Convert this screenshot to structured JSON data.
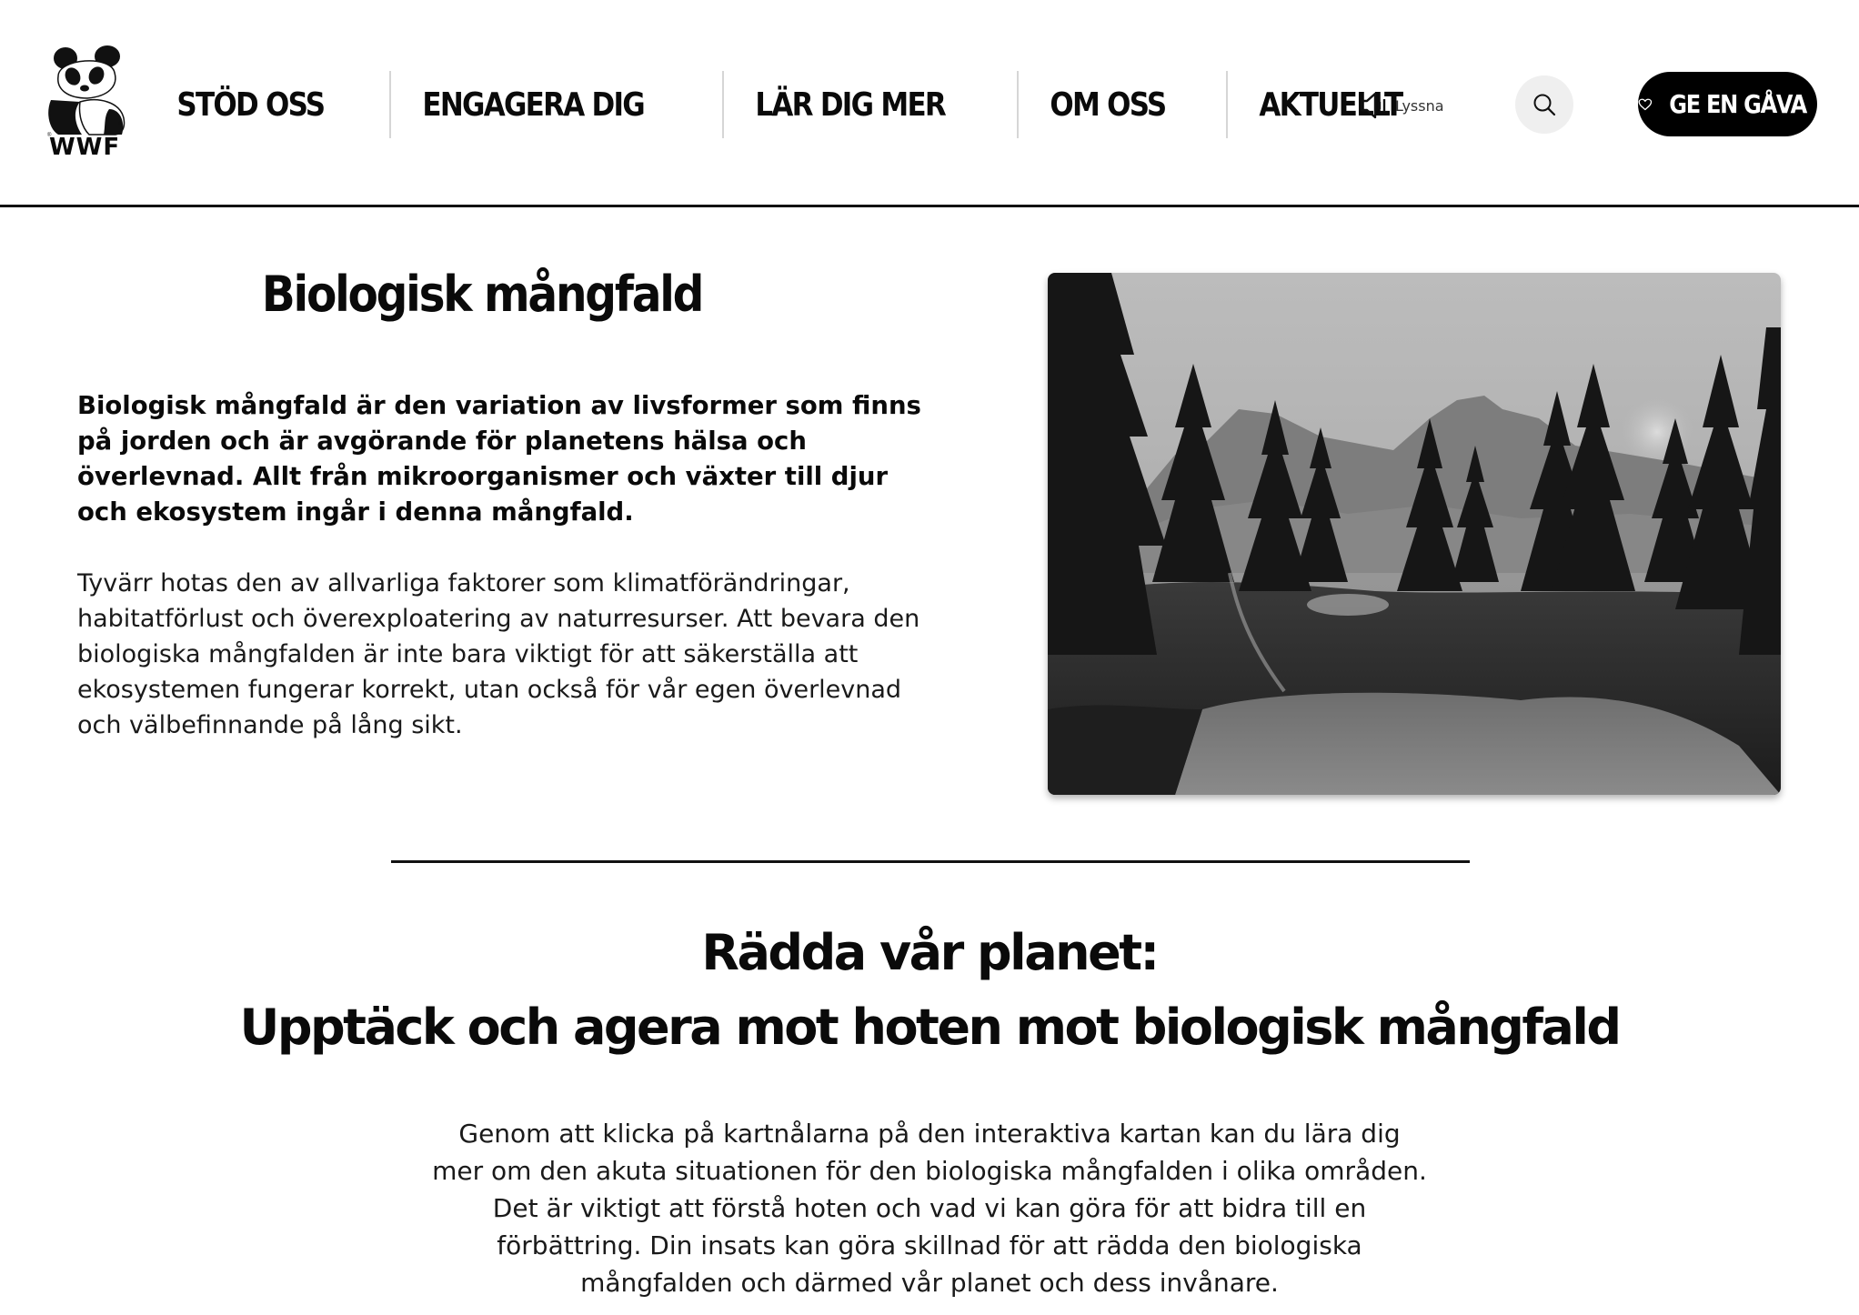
{
  "header": {
    "logo_text": "WWF",
    "nav": [
      "STÖD OSS",
      "ENGAGERA DIG",
      "LÄR DIG MER",
      "OM OSS",
      "AKTUELLT"
    ],
    "listen_label": "Lyssna",
    "gift_label": "GE EN GÅVA"
  },
  "intro": {
    "title": "Biologisk mångfald",
    "lead": "Biologisk mångfald är den variation av livsformer som finns på jorden och är avgörande för planetens hälsa och överlevnad. Allt från mikroorganismer och växter till djur och ekosystem ingår i denna mångfald.",
    "body": "Tyvärr hotas den av allvarliga faktorer som klimatförändringar, habitatförlust och överexploatering av naturresurser. Att bevara den biologiska mångfalden är inte bara viktigt för att säkerställa att ekosystemen fungerar korrekt, utan också för vår egen överlevnad och välbefinnande på lång sikt."
  },
  "threats": {
    "title_line1": "Rädda vår planet:",
    "title_line2": "Upptäck och agera mot hoten mot biologisk mångfald",
    "body": "Genom att klicka på kartnålarna på den interaktiva kartan kan du lära dig mer om den akuta situationen för den biologiska mångfalden i olika områden. Det är viktigt att förstå hoten och vad vi kan göra för att bidra till en förbättring. Din insats kan göra skillnad för att rädda den biologiska mångfalden och därmed vår planet och dess invånare."
  },
  "icons": {
    "logo": "panda-logo-icon",
    "listen": "speaker-icon",
    "search": "search-icon",
    "gift": "heart-icon"
  },
  "colors": {
    "text": "#0a0a0a",
    "button_bg": "#000000",
    "search_bg": "#efefef",
    "nav_separator": "#d6d6d6"
  }
}
